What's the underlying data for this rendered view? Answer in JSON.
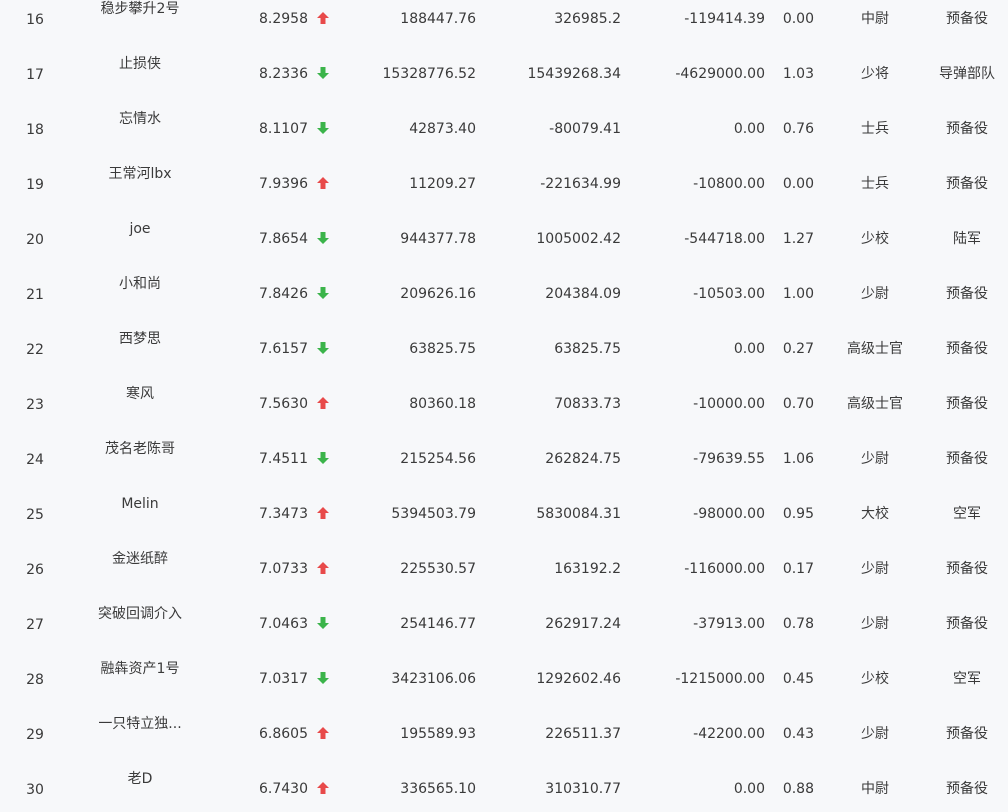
{
  "colors": {
    "up": "#e84a4a",
    "down": "#3bb44a",
    "text": "#3a3a3a",
    "background": "#f7f8fa"
  },
  "rows": [
    {
      "rank": "16",
      "name": "稳步攀升2号",
      "score": "8.2958",
      "trend": "up",
      "v1": "188447.76",
      "v2": "326985.2",
      "v3": "-119414.39",
      "v4": "0.00",
      "title": "中尉",
      "branch": "预备役"
    },
    {
      "rank": "17",
      "name": "止损侠",
      "score": "8.2336",
      "trend": "down",
      "v1": "15328776.52",
      "v2": "15439268.34",
      "v3": "-4629000.00",
      "v4": "1.03",
      "title": "少将",
      "branch": "导弹部队"
    },
    {
      "rank": "18",
      "name": "忘情水",
      "score": "8.1107",
      "trend": "down",
      "v1": "42873.40",
      "v2": "-80079.41",
      "v3": "0.00",
      "v4": "0.76",
      "title": "士兵",
      "branch": "预备役"
    },
    {
      "rank": "19",
      "name": "王常河lbx",
      "score": "7.9396",
      "trend": "up",
      "v1": "11209.27",
      "v2": "-221634.99",
      "v3": "-10800.00",
      "v4": "0.00",
      "title": "士兵",
      "branch": "预备役"
    },
    {
      "rank": "20",
      "name": "joe",
      "score": "7.8654",
      "trend": "down",
      "v1": "944377.78",
      "v2": "1005002.42",
      "v3": "-544718.00",
      "v4": "1.27",
      "title": "少校",
      "branch": "陆军"
    },
    {
      "rank": "21",
      "name": "小和尚",
      "score": "7.8426",
      "trend": "down",
      "v1": "209626.16",
      "v2": "204384.09",
      "v3": "-10503.00",
      "v4": "1.00",
      "title": "少尉",
      "branch": "预备役"
    },
    {
      "rank": "22",
      "name": "西梦思",
      "score": "7.6157",
      "trend": "down",
      "v1": "63825.75",
      "v2": "63825.75",
      "v3": "0.00",
      "v4": "0.27",
      "title": "高级士官",
      "branch": "预备役"
    },
    {
      "rank": "23",
      "name": "寒风",
      "score": "7.5630",
      "trend": "up",
      "v1": "80360.18",
      "v2": "70833.73",
      "v3": "-10000.00",
      "v4": "0.70",
      "title": "高级士官",
      "branch": "预备役"
    },
    {
      "rank": "24",
      "name": "茂名老陈哥",
      "score": "7.4511",
      "trend": "down",
      "v1": "215254.56",
      "v2": "262824.75",
      "v3": "-79639.55",
      "v4": "1.06",
      "title": "少尉",
      "branch": "预备役"
    },
    {
      "rank": "25",
      "name": "Melin",
      "score": "7.3473",
      "trend": "up",
      "v1": "5394503.79",
      "v2": "5830084.31",
      "v3": "-98000.00",
      "v4": "0.95",
      "title": "大校",
      "branch": "空军"
    },
    {
      "rank": "26",
      "name": "金迷纸醉",
      "score": "7.0733",
      "trend": "up",
      "v1": "225530.57",
      "v2": "163192.2",
      "v3": "-116000.00",
      "v4": "0.17",
      "title": "少尉",
      "branch": "预备役"
    },
    {
      "rank": "27",
      "name": "突破回调介入",
      "score": "7.0463",
      "trend": "down",
      "v1": "254146.77",
      "v2": "262917.24",
      "v3": "-37913.00",
      "v4": "0.78",
      "title": "少尉",
      "branch": "预备役"
    },
    {
      "rank": "28",
      "name": "融犇资产1号",
      "score": "7.0317",
      "trend": "down",
      "v1": "3423106.06",
      "v2": "1292602.46",
      "v3": "-1215000.00",
      "v4": "0.45",
      "title": "少校",
      "branch": "空军"
    },
    {
      "rank": "29",
      "name": "一只特立独...",
      "score": "6.8605",
      "trend": "up",
      "v1": "195589.93",
      "v2": "226511.37",
      "v3": "-42200.00",
      "v4": "0.43",
      "title": "少尉",
      "branch": "预备役"
    },
    {
      "rank": "30",
      "name": "老D",
      "score": "6.7430",
      "trend": "up",
      "v1": "336565.10",
      "v2": "310310.77",
      "v3": "0.00",
      "v4": "0.88",
      "title": "中尉",
      "branch": "预备役"
    }
  ]
}
